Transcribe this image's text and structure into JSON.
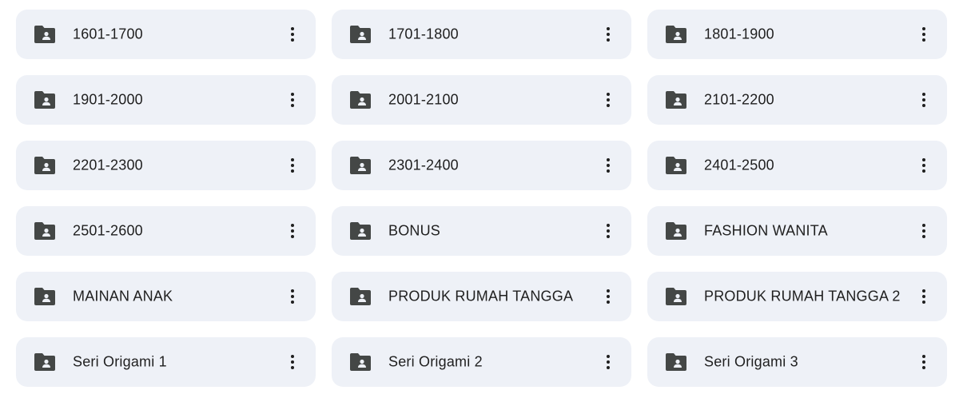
{
  "folders": [
    {
      "name": "1601-1700"
    },
    {
      "name": "1701-1800"
    },
    {
      "name": "1801-1900"
    },
    {
      "name": "1901-2000"
    },
    {
      "name": "2001-2100"
    },
    {
      "name": "2101-2200"
    },
    {
      "name": "2201-2300"
    },
    {
      "name": "2301-2400"
    },
    {
      "name": "2401-2500"
    },
    {
      "name": "2501-2600"
    },
    {
      "name": "BONUS"
    },
    {
      "name": "FASHION WANITA"
    },
    {
      "name": "MAINAN ANAK"
    },
    {
      "name": "PRODUK RUMAH TANGGA"
    },
    {
      "name": "PRODUK RUMAH TANGGA 2"
    },
    {
      "name": "Seri Origami 1"
    },
    {
      "name": "Seri Origami 2"
    },
    {
      "name": "Seri Origami 3"
    }
  ],
  "icons": {
    "folder": "shared-folder-icon",
    "more": "more-vert-icon"
  },
  "colors": {
    "card_background": "#eef1f7",
    "icon": "#444746",
    "text": "#1f1f1f"
  }
}
